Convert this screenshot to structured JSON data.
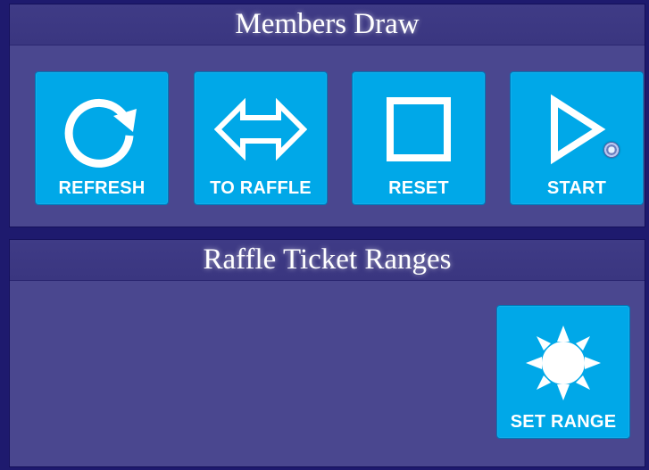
{
  "members_draw": {
    "title": "Members Draw",
    "buttons": [
      {
        "label": "REFRESH",
        "icon": "refresh-icon"
      },
      {
        "label": "TO RAFFLE",
        "icon": "double-arrow-icon"
      },
      {
        "label": "RESET",
        "icon": "stop-icon"
      },
      {
        "label": "START",
        "icon": "play-icon"
      }
    ]
  },
  "raffle_ranges": {
    "title": "Raffle Ticket Ranges",
    "buttons": [
      {
        "label": "SET RANGE",
        "icon": "sun-icon"
      }
    ]
  },
  "colors": {
    "background": "#1e1a6e",
    "panel": "#4a478f",
    "tile": "#00a8e8",
    "text": "#ffffff"
  }
}
